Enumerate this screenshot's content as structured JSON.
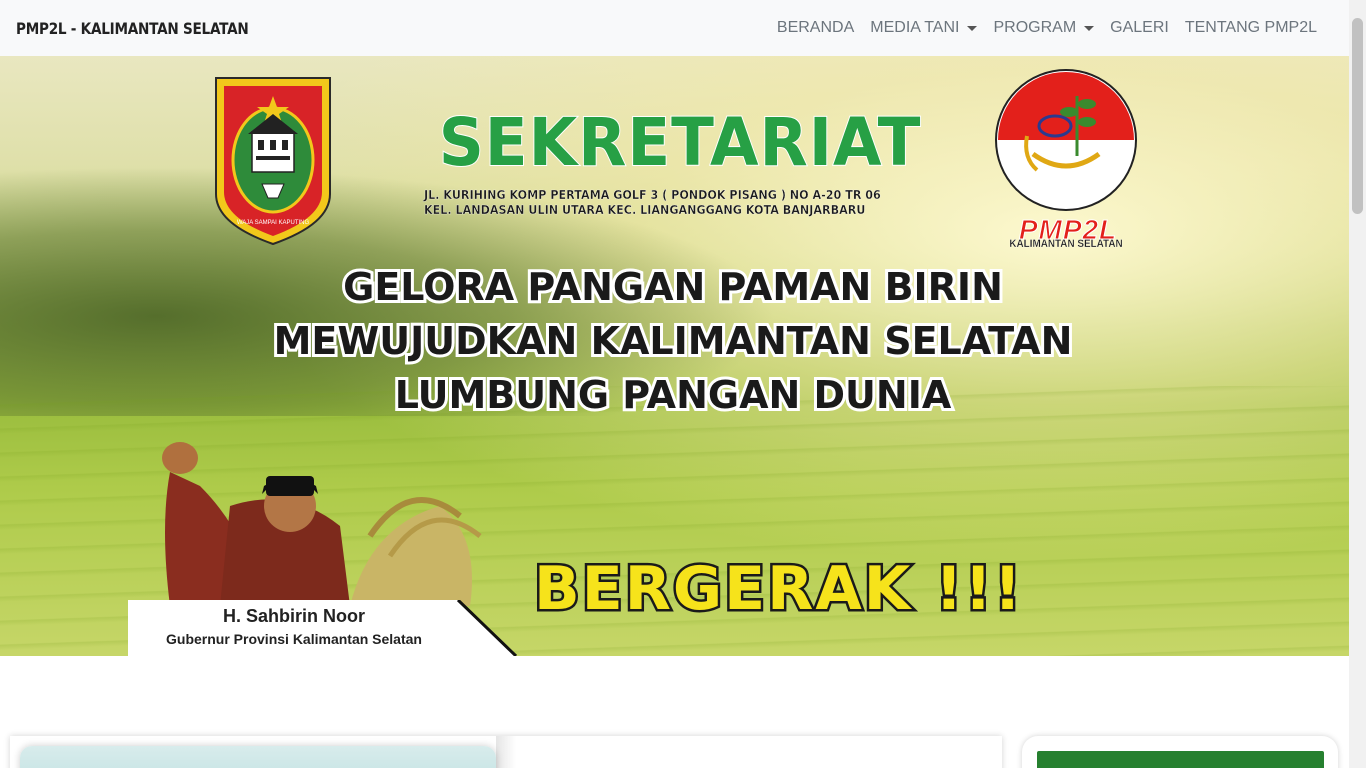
{
  "navbar": {
    "brand": "PMP2L - KALIMANTAN SELATAN",
    "items": [
      {
        "label": "BERANDA",
        "dropdown": false
      },
      {
        "label": "MEDIA TANI",
        "dropdown": true
      },
      {
        "label": "PROGRAM",
        "dropdown": true
      },
      {
        "label": "GALERI",
        "dropdown": false
      },
      {
        "label": "TENTANG PMP2L",
        "dropdown": false
      }
    ]
  },
  "banner": {
    "heading": "SEKRETARIAT",
    "address_line1": "JL. KURIHING KOMP PERTAMA GOLF 3 ( PONDOK PISANG ) NO A-20 TR 06",
    "address_line2": "KEL. LANDASAN ULIN UTARA KEC. LIANGANGGANG KOTA BANJARBARU",
    "slogan_line1": "GELORA PANGAN PAMAN BIRIN",
    "slogan_line2": "MEWUJUDKAN KALIMANTAN SELATAN",
    "slogan_line3": "LUMBUNG PANGAN DUNIA",
    "call_to_action": "BERGERAK !!!",
    "governor_name": "H. Sahbirin Noor",
    "governor_title": "Gubernur Provinsi Kalimantan Selatan",
    "left_emblem_motto": "WAJA SAMPAI KAPUTING",
    "right_logo_ring_text": "MANDIRI MAKMUR SEJAHTERA",
    "right_logo_name": "PMP2L",
    "right_logo_sub": "KALIMANTAN SELATAN"
  },
  "colors": {
    "sekretariat_green": "#27a045",
    "bergerak_yellow": "#f6e31b",
    "pmp2l_red": "#e3201b",
    "card_header_green": "#26802f"
  }
}
